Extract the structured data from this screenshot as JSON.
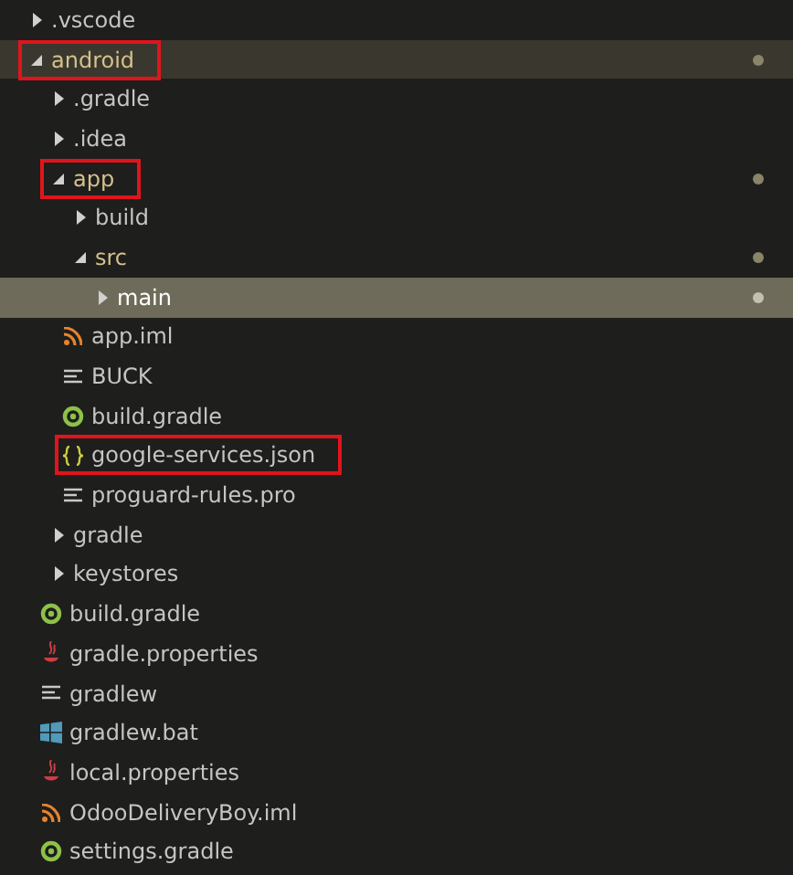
{
  "tree": [
    {
      "name": ".vscode",
      "kind": "folder",
      "expanded": false,
      "selected": false,
      "hovered": false,
      "modified": false,
      "annotated": false
    },
    {
      "name": "android",
      "kind": "folder",
      "expanded": true,
      "selected": false,
      "hovered": true,
      "modified": true,
      "annotated": true,
      "children": [
        {
          "name": ".gradle",
          "kind": "folder",
          "expanded": false,
          "selected": false,
          "hovered": false,
          "modified": false,
          "annotated": false
        },
        {
          "name": ".idea",
          "kind": "folder",
          "expanded": false,
          "selected": false,
          "hovered": false,
          "modified": false,
          "annotated": false
        },
        {
          "name": "app",
          "kind": "folder",
          "expanded": true,
          "selected": false,
          "hovered": false,
          "modified": true,
          "annotated": true,
          "children": [
            {
              "name": "build",
              "kind": "folder",
              "expanded": false,
              "selected": false,
              "hovered": false,
              "modified": false,
              "annotated": false
            },
            {
              "name": "src",
              "kind": "folder",
              "expanded": true,
              "selected": false,
              "hovered": false,
              "modified": true,
              "annotated": false,
              "children": [
                {
                  "name": "main",
                  "kind": "folder",
                  "expanded": false,
                  "selected": true,
                  "hovered": false,
                  "modified": true,
                  "annotated": false
                }
              ]
            },
            {
              "name": "app.iml",
              "kind": "feed",
              "selected": false,
              "hovered": false,
              "modified": false,
              "annotated": false
            },
            {
              "name": "BUCK",
              "kind": "text",
              "selected": false,
              "hovered": false,
              "modified": false,
              "annotated": false
            },
            {
              "name": "build.gradle",
              "kind": "gradle",
              "selected": false,
              "hovered": false,
              "modified": false,
              "annotated": false
            },
            {
              "name": "google-services.json",
              "kind": "json",
              "selected": false,
              "hovered": false,
              "modified": false,
              "annotated": true
            },
            {
              "name": "proguard-rules.pro",
              "kind": "text",
              "selected": false,
              "hovered": false,
              "modified": false,
              "annotated": false
            }
          ]
        },
        {
          "name": "gradle",
          "kind": "folder",
          "expanded": false,
          "selected": false,
          "hovered": false,
          "modified": false,
          "annotated": false
        },
        {
          "name": "keystores",
          "kind": "folder",
          "expanded": false,
          "selected": false,
          "hovered": false,
          "modified": false,
          "annotated": false
        },
        {
          "name": "build.gradle",
          "kind": "gradle",
          "selected": false,
          "hovered": false,
          "modified": false,
          "annotated": false
        },
        {
          "name": "gradle.properties",
          "kind": "properties",
          "selected": false,
          "hovered": false,
          "modified": false,
          "annotated": false
        },
        {
          "name": "gradlew",
          "kind": "text",
          "selected": false,
          "hovered": false,
          "modified": false,
          "annotated": false
        },
        {
          "name": "gradlew.bat",
          "kind": "windows",
          "selected": false,
          "hovered": false,
          "modified": false,
          "annotated": false
        },
        {
          "name": "local.properties",
          "kind": "properties",
          "selected": false,
          "hovered": false,
          "modified": false,
          "annotated": false
        },
        {
          "name": "OdooDeliveryBoy.iml",
          "kind": "feed",
          "selected": false,
          "hovered": false,
          "modified": false,
          "annotated": false
        },
        {
          "name": "settings.gradle",
          "kind": "gradle",
          "selected": false,
          "hovered": false,
          "modified": false,
          "annotated": false
        }
      ]
    }
  ]
}
